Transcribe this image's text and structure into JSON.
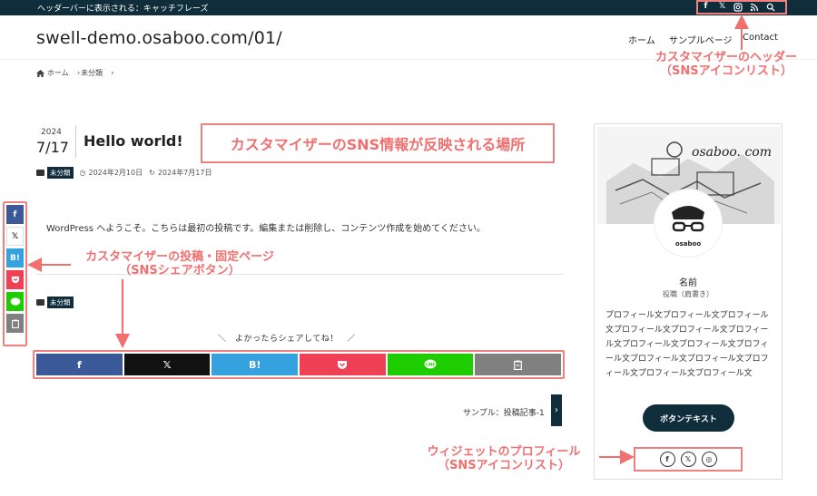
{
  "topbar": {
    "catchphrase": "ヘッダーバーに表示される：キャッチフレーズ",
    "icons": [
      "facebook-icon",
      "x-icon",
      "instagram-icon",
      "rss-icon",
      "search-icon"
    ]
  },
  "header": {
    "site_title": "swell-demo.osaboo.com/01/",
    "nav": [
      "ホーム",
      "サンプルページ",
      "Contact"
    ]
  },
  "breadcrumb": [
    "ホーム",
    "未分類"
  ],
  "post": {
    "year": "2024",
    "month_day": "7/17",
    "title": "Hello world!",
    "category": "未分類",
    "published": "2024年2月10日",
    "updated": "2024年7月17日",
    "body": "WordPress へようこそ。こちらは最初の投稿です。編集または削除し、コンテンツ作成を始めてください。",
    "footer_category": "未分類"
  },
  "share": {
    "caption": "＼　よかったらシェアしてね！　／",
    "buttons": [
      {
        "name": "facebook",
        "label": "f",
        "color": "#3b5998"
      },
      {
        "name": "x",
        "label": "𝕏",
        "color": "#111111"
      },
      {
        "name": "hatena",
        "label": "B!",
        "color": "#35a1df"
      },
      {
        "name": "pocket",
        "label": "⬙",
        "color": "#ef4056"
      },
      {
        "name": "line",
        "label": "LINE",
        "color": "#1dcd00"
      },
      {
        "name": "copy",
        "label": "⎘",
        "color": "#808080"
      }
    ]
  },
  "pager": {
    "next_label": "サンプル：投稿記事-1",
    "arrow": "›"
  },
  "profile": {
    "cover_text": "osaboo. com",
    "name": "名前",
    "role": "役職（肩書き）",
    "description": "プロフィール文プロフィール文プロフィール文プロフィール文プロフィール文プロフィール文プロフィール文プロフィール文プロフィール文プロフィール文プロフィール文プロフィール文プロフィール文プロフィール文",
    "button": "ボタンテキスト",
    "sns": [
      "f",
      "𝕏",
      "◎"
    ]
  },
  "annotations": {
    "callout": "カスタマイザーのSNS情報が反映される場所",
    "header_line1": "カスタマイザーのヘッダー",
    "header_line2": "（SNSアイコンリスト）",
    "post_line1": "カスタマイザーの投稿・固定ページ",
    "post_line2": "（SNSシェアボタン）",
    "widget_line1": "ウィジェットのプロフィール",
    "widget_line2": "（SNSアイコンリスト）",
    "accent_color": "#f07070"
  }
}
